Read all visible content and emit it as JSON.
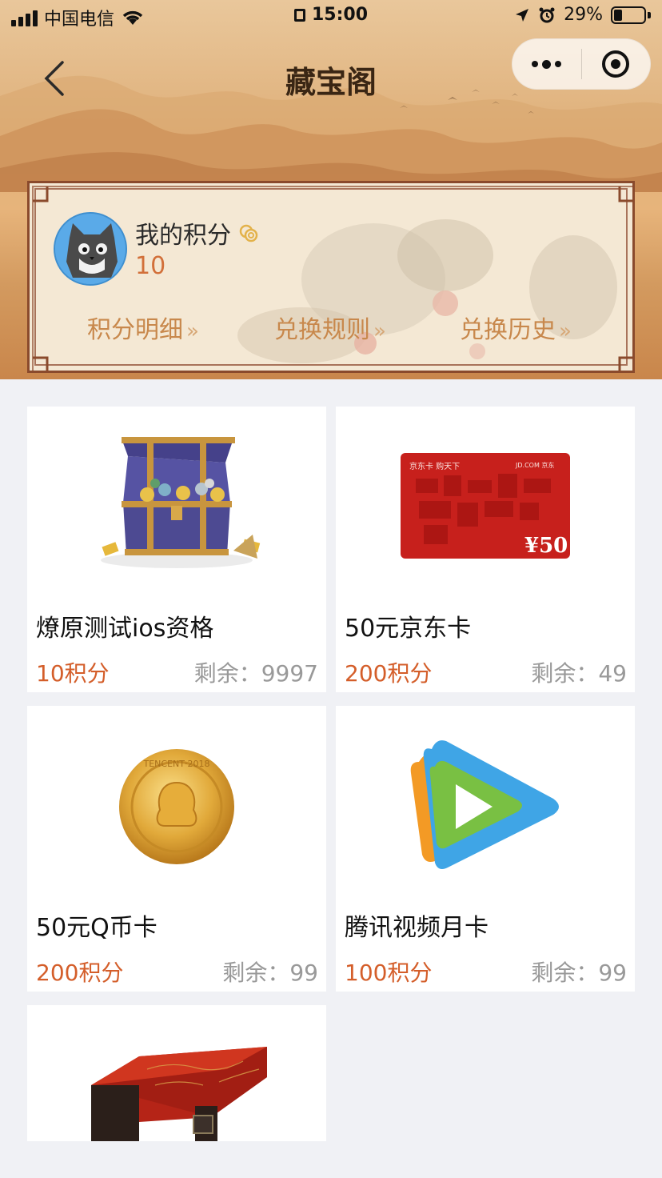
{
  "status_bar": {
    "carrier": "中国电信",
    "time": "15:00",
    "battery": "29%"
  },
  "nav": {
    "title": "藏宝阁"
  },
  "points_card": {
    "label": "我的积分",
    "value": "10",
    "links": [
      {
        "label": "积分明细"
      },
      {
        "label": "兑换规则"
      },
      {
        "label": "兑换历史"
      }
    ]
  },
  "products": [
    {
      "name": "燎原测试ios资格",
      "price": "10积分",
      "stock_label": "剩余：",
      "stock": "9997",
      "image": "treasure-chest"
    },
    {
      "name": "50元京东卡",
      "price": "200积分",
      "stock_label": "剩余：",
      "stock": "49",
      "image": "jd-card",
      "card_text": {
        "top_left": "京东卡 购天下",
        "top_right": "JD.COM 京东",
        "amount": "¥50"
      }
    },
    {
      "name": "50元Q币卡",
      "price": "200积分",
      "stock_label": "剩余：",
      "stock": "99",
      "image": "gold-coin",
      "coin_text": "TENCENT·2018"
    },
    {
      "name": "腾讯视频月卡",
      "price": "100积分",
      "stock_label": "剩余：",
      "stock": "99",
      "image": "tencent-video-logo"
    },
    {
      "image": "lacquer-box"
    }
  ],
  "colors": {
    "price": "#d45e2a",
    "points_value": "#d2703a",
    "link": "#c8884c",
    "card_border": "#8a4a2c"
  }
}
